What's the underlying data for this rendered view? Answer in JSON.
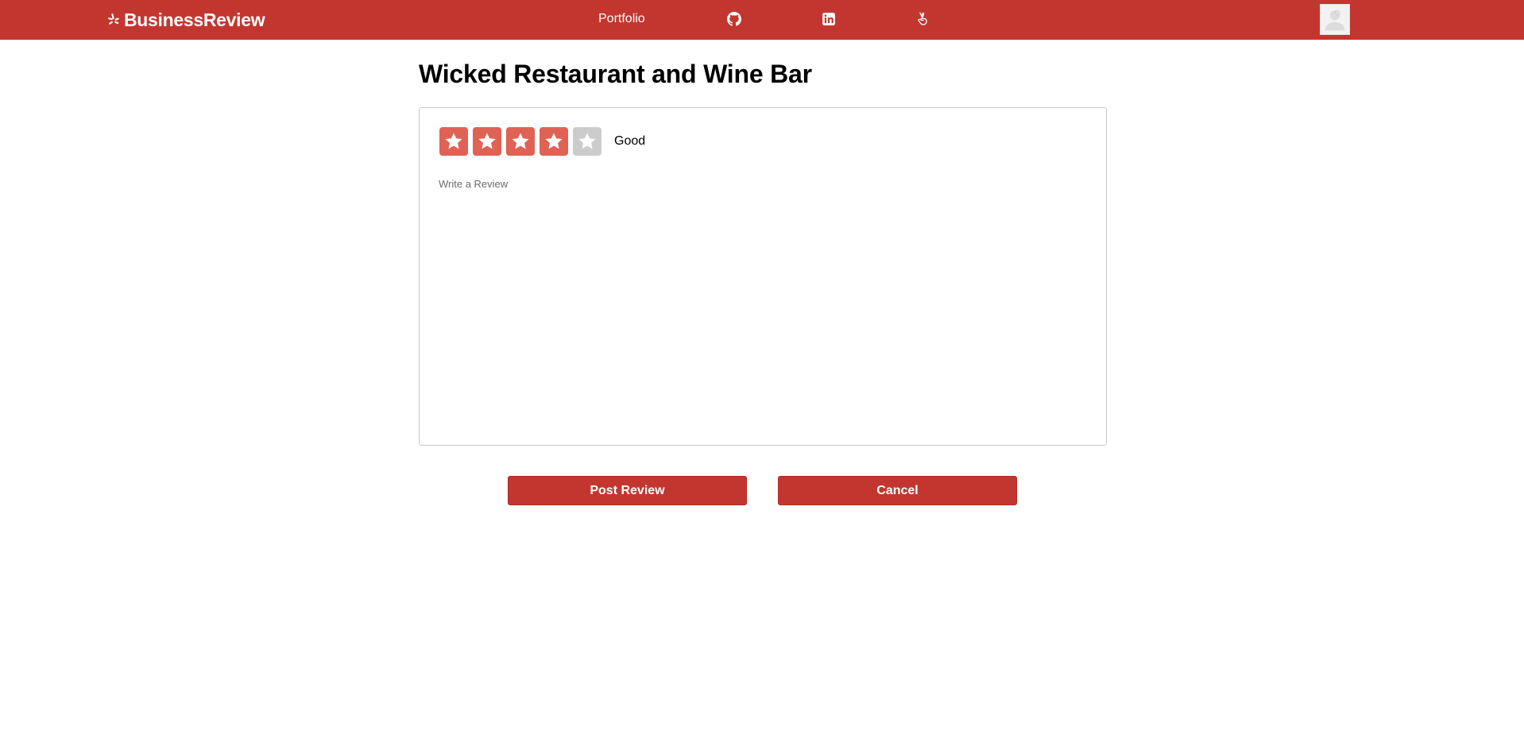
{
  "navbar": {
    "brand": "BusinessReview",
    "brand_icon": "yelp-burst-icon",
    "links": [
      {
        "label": "Portfolio"
      }
    ],
    "icons": [
      "github-icon",
      "linkedin-icon",
      "angellist-icon"
    ],
    "avatar_icon": "user-avatar-icon"
  },
  "page": {
    "title": "Wicked Restaurant and Wine Bar"
  },
  "review": {
    "rating": 4,
    "max_rating": 5,
    "rating_label": "Good",
    "placeholder": "Write a Review",
    "value": ""
  },
  "actions": {
    "post_label": "Post Review",
    "cancel_label": "Cancel"
  },
  "colors": {
    "brand": "#c3362f",
    "star_active": "#e06254",
    "star_inactive": "#cccccc"
  }
}
